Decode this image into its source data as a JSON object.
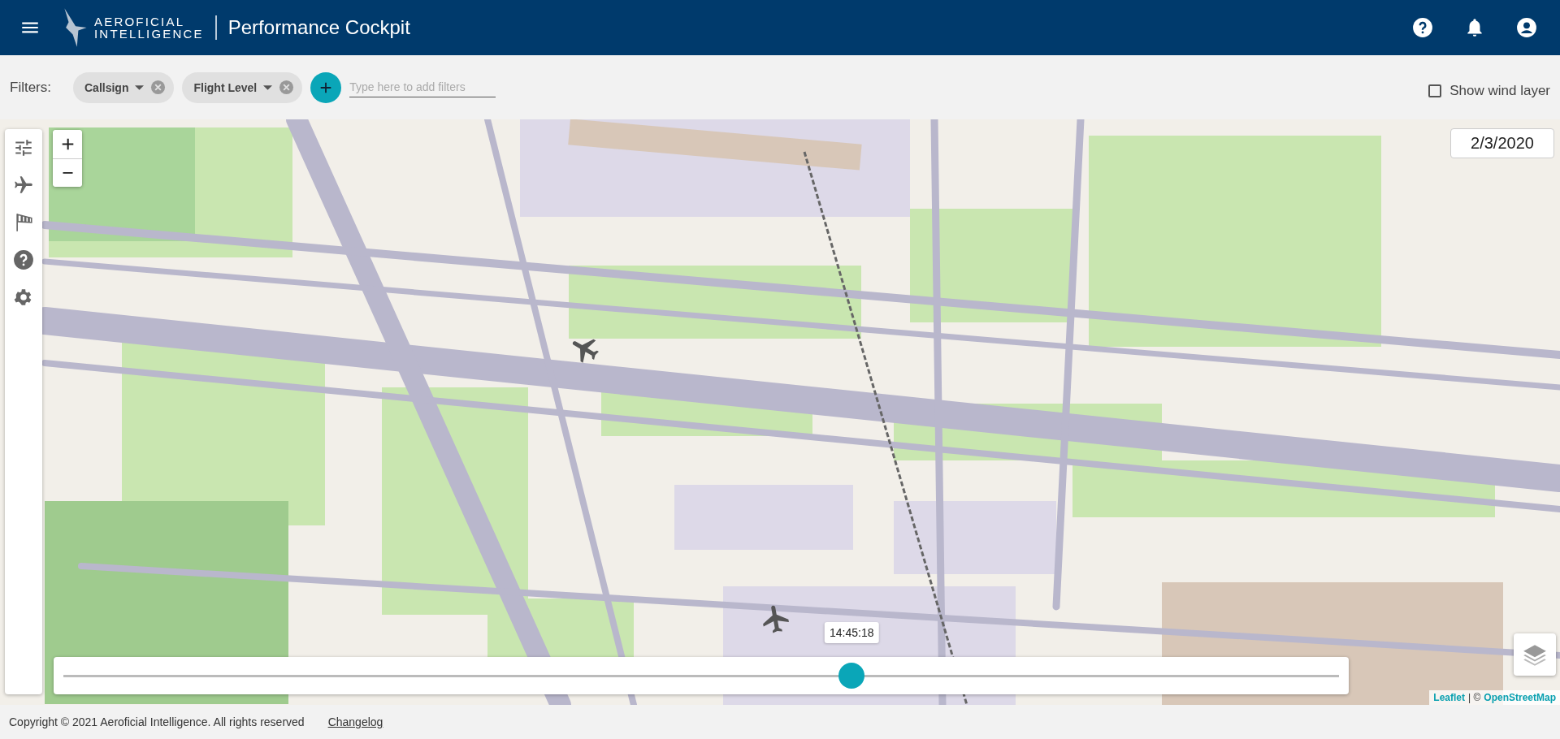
{
  "header": {
    "brand_line_1": "AEROFICIAL",
    "brand_line_2": "INTELLIGENCE",
    "title": "Performance Cockpit"
  },
  "filters": {
    "label": "Filters:",
    "chips": [
      {
        "label": "Callsign"
      },
      {
        "label": "Flight Level"
      }
    ],
    "input": {
      "placeholder": "Type here to add filters"
    },
    "wind_layer": {
      "label": "Show wind layer",
      "checked": false
    }
  },
  "map": {
    "date": "2/3/2020",
    "timeline": {
      "time_label": "14:45:18",
      "level": 0.618
    },
    "attribution": {
      "link_1": "Leaflet",
      "separator": "| ©",
      "link_2": "OpenStreetMap"
    }
  },
  "footer": {
    "copyright": "Copyright © 2021 Aeroficial Intelligence. All rights reserved",
    "changelog": "Changelog"
  }
}
